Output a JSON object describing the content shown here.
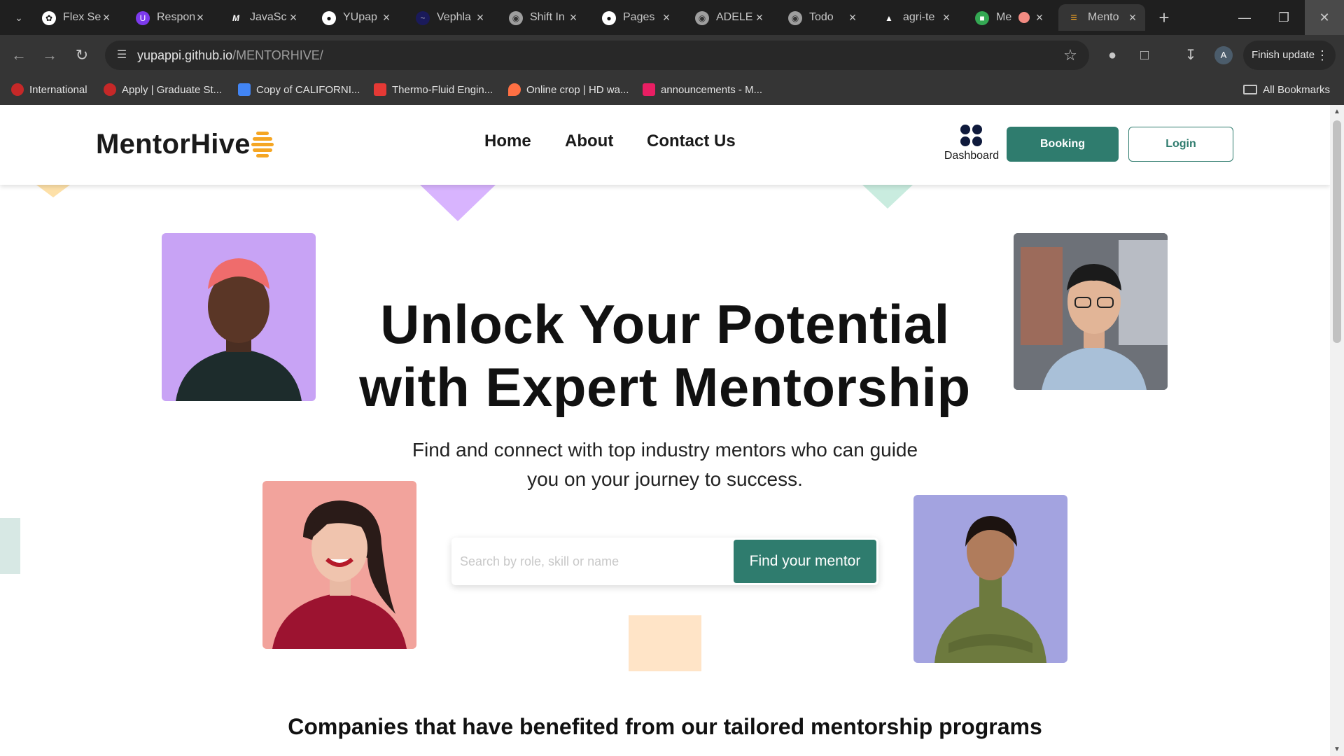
{
  "browser": {
    "tabs": [
      {
        "title": "Flex Se",
        "icon": "openai-icon",
        "color": "#ffffff"
      },
      {
        "title": "Respon",
        "icon": "u-icon",
        "color": "#7c3aed"
      },
      {
        "title": "JavaSc",
        "icon": "m-icon",
        "color": "#ffffff"
      },
      {
        "title": "YUpap",
        "icon": "github-icon",
        "color": "#ffffff"
      },
      {
        "title": "Vephla",
        "icon": "vephla-icon",
        "color": "#3b3bb3"
      },
      {
        "title": "Shift In",
        "icon": "globe-icon",
        "color": "#9e9e9e"
      },
      {
        "title": "Pages",
        "icon": "github-icon",
        "color": "#ffffff"
      },
      {
        "title": "ADELE",
        "icon": "globe-icon",
        "color": "#9e9e9e"
      },
      {
        "title": "Todo",
        "icon": "globe-icon",
        "color": "#9e9e9e"
      },
      {
        "title": "agri-te",
        "icon": "vercel-icon",
        "color": "#ffffff"
      },
      {
        "title": "Me",
        "icon": "meet-icon",
        "color": "#34a853"
      },
      {
        "title": "Mento",
        "icon": "mentorhive-icon",
        "color": "#f5a623"
      }
    ],
    "new_tab": "+",
    "url_host": "yupappi.github.io",
    "url_path": "/MENTORHIVE/",
    "profile_initial": "A",
    "finish_update": "Finish update",
    "bookmarks": [
      {
        "label": "International",
        "color": "#c62828"
      },
      {
        "label": "Apply | Graduate St...",
        "color": "#c62828"
      },
      {
        "label": "Copy of CALIFORNI...",
        "color": "#4285f4"
      },
      {
        "label": "Thermo-Fluid Engin...",
        "color": "#e53935"
      },
      {
        "label": "Online crop | HD wa...",
        "color": "#ff7043"
      },
      {
        "label": "announcements - M...",
        "color": "#e91e63"
      }
    ],
    "all_bookmarks": "All Bookmarks"
  },
  "site": {
    "brand": "MentorHive",
    "nav": {
      "home": "Home",
      "about": "About",
      "contact": "Contact Us"
    },
    "dashboard_label": "Dashboard",
    "booking_label": "Booking",
    "login_label": "Login",
    "hero_title_line1": "Unlock Your Potential",
    "hero_title_line2": "with Expert Mentorship",
    "hero_sub_line1": "Find and connect with top industry mentors who can guide",
    "hero_sub_line2": "you on your journey to success.",
    "search_placeholder": "Search by role, skill or name",
    "search_button": "Find your mentor",
    "companies_heading": "Companies that have benefited from our tailored mentorship programs",
    "accent": "#2f7c6e"
  }
}
